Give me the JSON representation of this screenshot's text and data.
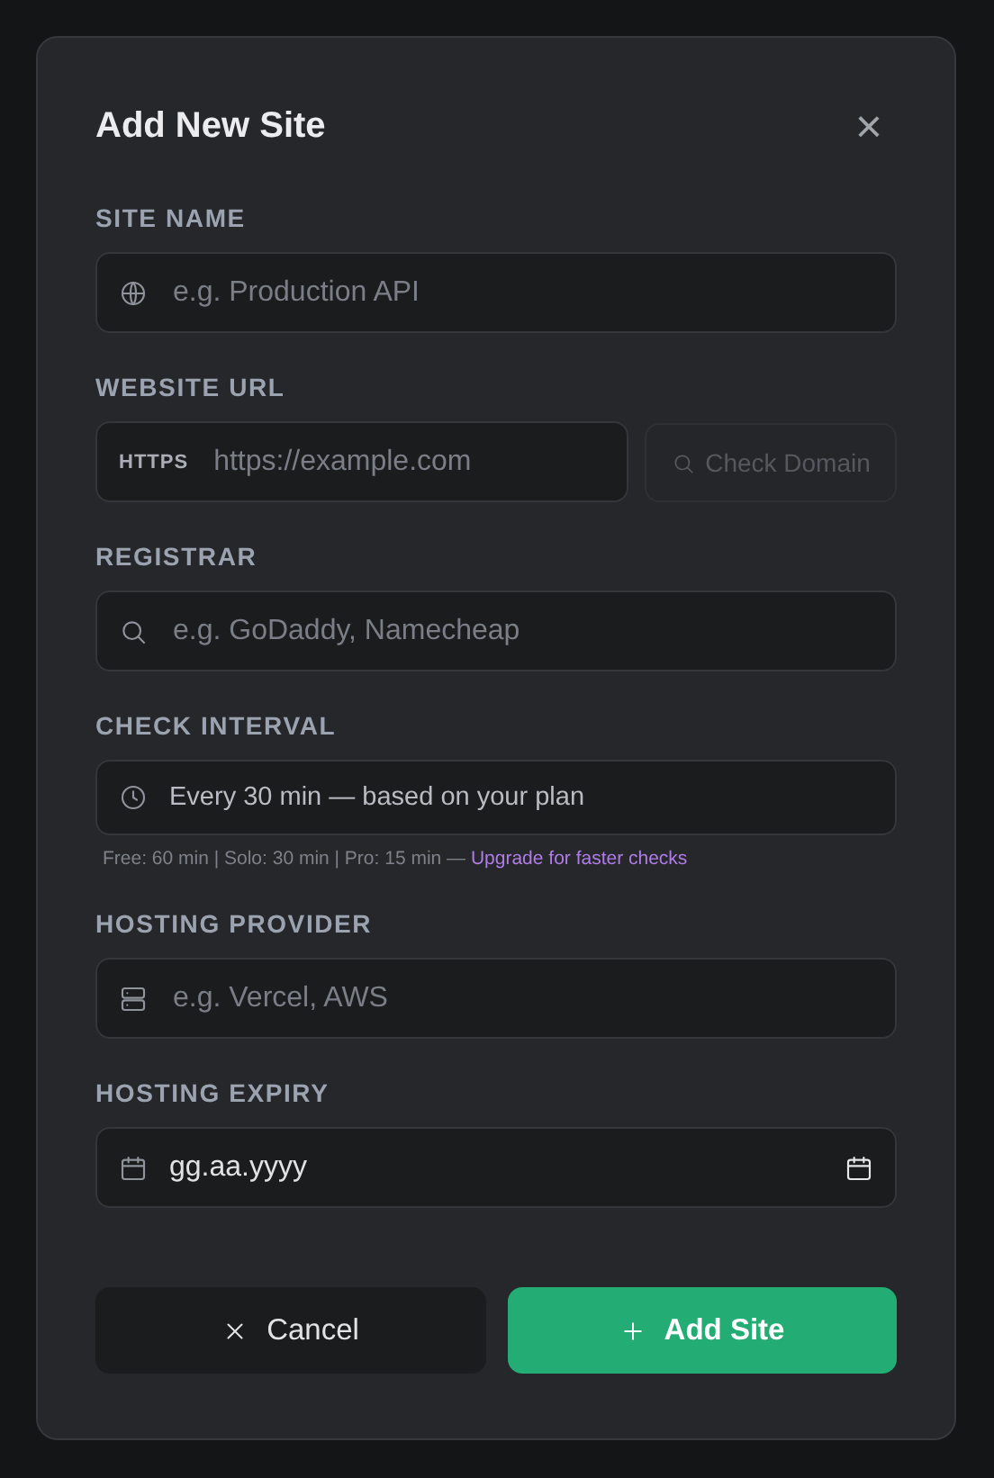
{
  "dialog": {
    "title": "Add New Site",
    "close": "×"
  },
  "fields": [
    {
      "kind": "site",
      "label": "SITE NAME",
      "placeholder": "e.g. Production API"
    },
    {
      "kind": "url",
      "label": "WEBSITE URL",
      "prefix": "HTTPS",
      "placeholder": "https://example.com",
      "button": {
        "label": "Check Domain",
        "disabled": true
      }
    },
    {
      "kind": "registrar",
      "label": "REGISTRAR",
      "placeholder": "e.g. GoDaddy, Namecheap"
    },
    {
      "kind": "interval",
      "label": "CHECK INTERVAL",
      "value": "Every 30 min — based on your plan",
      "hint": "Free: 60 min | Solo: 30 min | Pro: 15 min —",
      "hint_link": "Upgrade for faster checks"
    },
    {
      "kind": "hosting",
      "label": "HOSTING PROVIDER",
      "placeholder": "e.g. Vercel, AWS"
    },
    {
      "kind": "date",
      "label": "HOSTING EXPIRY",
      "value": "gg.aa.yyyy"
    }
  ],
  "buttons": [
    {
      "kind": "cancel",
      "label": "Cancel"
    },
    {
      "kind": "add",
      "label": "Add Site"
    }
  ]
}
